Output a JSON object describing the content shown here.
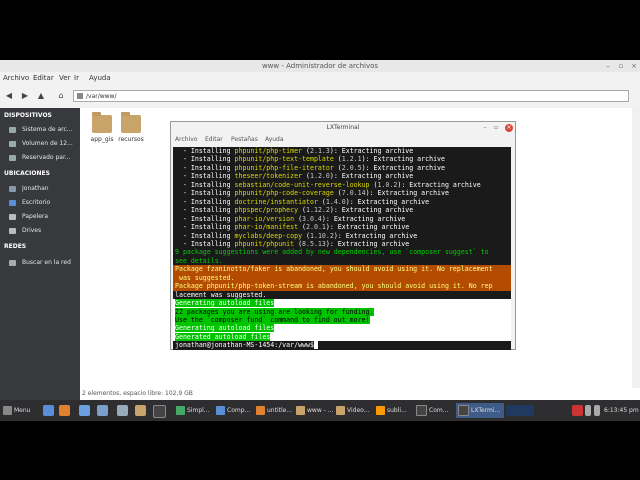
{
  "file_manager": {
    "title": "www - Administrador de archivos",
    "menu": [
      "Archivo",
      "Editar",
      "Ver",
      "Ir",
      "Ayuda"
    ],
    "path": "/var/www/",
    "sidebar": {
      "devices_heading": "DISPOSITIVOS",
      "devices": [
        "Sistema de arc...",
        "Volumen de 12...",
        "Reservado par..."
      ],
      "places_heading": "UBICACIONES",
      "places": [
        "Jonathan",
        "Escritorio",
        "Papelera",
        "Drives"
      ],
      "network_heading": "REDES",
      "network": [
        "Buscar en la red"
      ]
    },
    "folders": [
      "app_gis",
      "recursos"
    ],
    "status": "2 elementos, espacio libre: 102,9 GB"
  },
  "terminal": {
    "title": "LXTerminal",
    "menu": [
      "Archivo",
      "Editar",
      "Pestañas",
      "Ayuda"
    ],
    "installs": [
      {
        "pkg": "phpunit/php-timer",
        "ver": "2.1.3"
      },
      {
        "pkg": "phpunit/php-text-template",
        "ver": "1.2.1"
      },
      {
        "pkg": "phpunit/php-file-iterator",
        "ver": "2.0.5"
      },
      {
        "pkg": "theseer/tokenizer",
        "ver": "1.2.0"
      },
      {
        "pkg": "sebastian/code-unit-reverse-lookup",
        "ver": "1.0.2"
      },
      {
        "pkg": "phpunit/php-code-coverage",
        "ver": "7.0.14"
      },
      {
        "pkg": "doctrine/instantiator",
        "ver": "1.4.0"
      },
      {
        "pkg": "phpspec/prophecy",
        "ver": "1.12.2"
      },
      {
        "pkg": "phar-io/version",
        "ver": "3.0.4"
      },
      {
        "pkg": "phar-io/manifest",
        "ver": "2.0.1"
      },
      {
        "pkg": "myclabs/deep-copy",
        "ver": "1.10.2"
      },
      {
        "pkg": "phpunit/phpunit",
        "ver": "8.5.13"
      }
    ],
    "install_prefix": "  - Installing ",
    "install_suffix": "): Extracting archive",
    "suggest_1": "9 package suggestions were added by new dependencies, use `composer suggest` to",
    "suggest_2": "see details.",
    "abandoned_1": "Package fzaninotto/faker is abandoned, you should avoid using it. No replacement",
    "abandoned_2": " was suggested.",
    "abandoned_3": "Package phpunit/php-token-stream is abandoned, you should avoid using it. No rep",
    "abandoned_4": "lacement was suggested.",
    "gen_1": "Generating autoload files",
    "fund_1": "22 packages you are using are looking for funding.",
    "fund_2": "Use the `composer fund` command to find out more!",
    "gen_2": "Generating autoload files",
    "gen_3": "Generated autoload files",
    "prompt": "jonathan@jonathan-MS-1454:/var/www$"
  },
  "taskbar": {
    "menu_label": "Menu",
    "tasks": [
      "Simpl...",
      "Comp...",
      "untitle...",
      "www - ...",
      "Video...",
      "subli...",
      "Com...",
      "LXTermi..."
    ],
    "clock": "6:13:45 pm"
  }
}
